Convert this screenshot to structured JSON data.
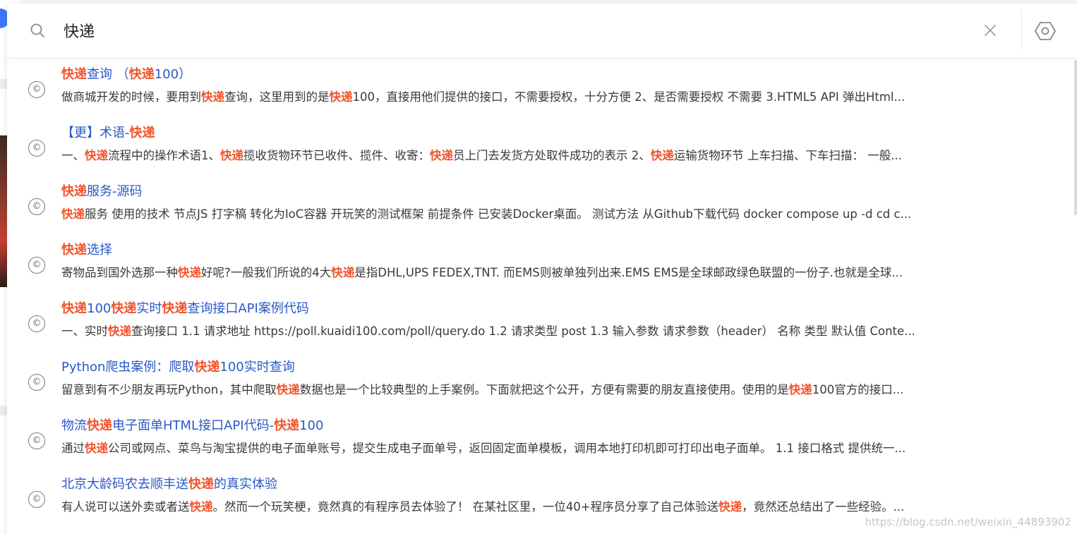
{
  "search": {
    "query": "快递",
    "highlight": "快递"
  },
  "results": [
    {
      "title": "快递查询 （快递100）",
      "desc": "做商城开发的时候，要用到快递查询，这里用到的是快递100，直接用他们提供的接口，不需要授权，十分方便 2、是否需要授权 不需要 3.HTML5 API 弹出Html..."
    },
    {
      "title": "【更】术语-快递",
      "desc": "一、快递流程中的操作术语1、快递揽收货物环节已收件、揽件、收寄：快递员上门去发货方处取件成功的表示 2、快递运输货物环节 上车扫描、下车扫描： 一般..."
    },
    {
      "title": "快递服务-源码",
      "desc": "快递服务 使用的技术 节点JS 打字稿 转化为IoC容器 开玩笑的测试框架 前提条件 已安装Docker桌面。 测试方法 从Github下载代码 docker compose up -d cd c..."
    },
    {
      "title": "快递选择",
      "desc": "寄物品到国外选那一种快递好呢?一般我们所说的4大快递是指DHL,UPS FEDEX,TNT. 而EMS则被单独列出来.EMS EMS是全球邮政绿色联盟的一份子.也就是全球..."
    },
    {
      "title": "快递100快递实时快递查询接口API案例代码",
      "desc": "一、实时快递查询接口 1.1 请求地址 https://poll.kuaidi100.com/poll/query.do 1.2 请求类型 post 1.3 输入参数 请求参数（header） 名称 类型 默认值 Conte..."
    },
    {
      "title": "Python爬虫案例：爬取快递100实时查询",
      "desc": "留意到有不少朋友再玩Python，其中爬取快递数据也是一个比较典型的上手案例。下面就把这个公开，方便有需要的朋友直接使用。使用的是快递100官方的接口..."
    },
    {
      "title": "物流快递电子面单HTML接口API代码-快递100",
      "desc": "通过快递公司或网点、菜鸟与淘宝提供的电子面单账号，提交生成电子面单号，返回固定面单模板，调用本地打印机即可打印出电子面单。 1.1 接口格式 提供统一..."
    },
    {
      "title": "北京大龄码农去顺丰送快递的真实体验",
      "desc": "有人说可以送外卖或者送快递。然而一个玩笑梗，竟然真的有程序员去体验了！ 在某社区里，一位40+程序员分享了自己体验送快递，竟然还总结出了一些经验。..."
    }
  ],
  "result_icon_glyph": "©",
  "watermark": "https://blog.csdn.net/weixin_44893902",
  "icons": {
    "search": "search-icon",
    "clear": "close-icon",
    "settings": "hexagon-settings-icon",
    "result": "copyright-circle-icon"
  },
  "colors": {
    "title": "#2a59c7",
    "highlight": "#f2542d",
    "desc": "#3a3a3a"
  }
}
